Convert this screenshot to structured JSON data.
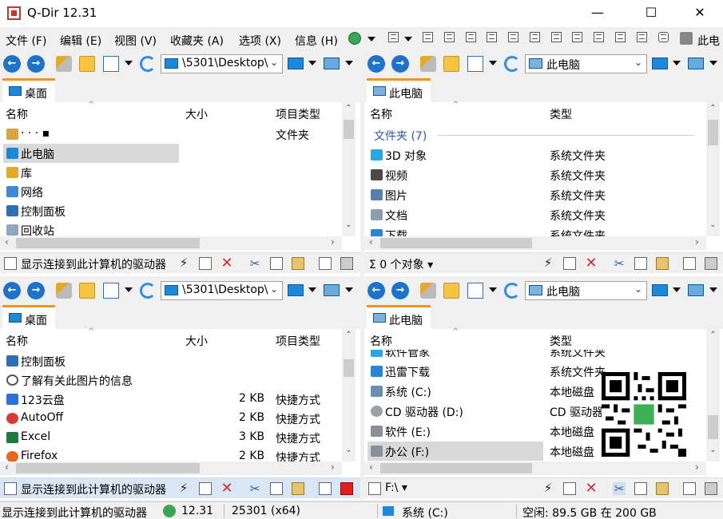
{
  "window": {
    "title": "Q-Dir 12.31",
    "min_glyph": "—",
    "max_glyph": "☐",
    "close_glyph": "✕"
  },
  "menu": {
    "items": [
      "文件 (F)",
      "编辑 (E)",
      "视图 (V)",
      "收藏夹 (A)",
      "选项 (X)",
      "信息 (H)"
    ],
    "this_pc": "此电"
  },
  "glyphs": {
    "back": "←",
    "forward": "→",
    "chevron": "⌄",
    "caret_up": "^",
    "left": "‹",
    "right": "›",
    "up": "⌃",
    "down": "⌄",
    "drop": "▾",
    "bolt": "⚡",
    "x": "✕",
    "cut": "✂"
  },
  "panes": {
    "top_left": {
      "address": "\\5301\\Desktop\\",
      "tab": "桌面",
      "columns": [
        "名称",
        "大小",
        "项目类型"
      ],
      "rows": [
        {
          "name": "· · ·  ▪",
          "size": "",
          "type": "文件夹",
          "icon_color": "#d9a441"
        },
        {
          "name": "此电脑",
          "size": "",
          "type": "",
          "icon_color": "#1e88d8",
          "selected": true
        },
        {
          "name": "库",
          "size": "",
          "type": "",
          "icon_color": "#e6a92a"
        },
        {
          "name": "网络",
          "size": "",
          "type": "",
          "icon_color": "#3a8ad6"
        },
        {
          "name": "控制面板",
          "size": "",
          "type": "",
          "icon_color": "#2f6fb5"
        },
        {
          "name": "回收站",
          "size": "",
          "type": "",
          "icon_color": "#8fa8c0"
        }
      ],
      "footer": "显示连接到此计算机的驱动器"
    },
    "top_right": {
      "address": "此电脑",
      "tab": "此电脑",
      "columns": [
        "名称",
        "类型"
      ],
      "group": "文件夹 (7)",
      "rows": [
        {
          "name": "3D 对象",
          "type": "系统文件夹",
          "icon_color": "#2aa6e0"
        },
        {
          "name": "视频",
          "type": "系统文件夹",
          "icon_color": "#4a4a4a"
        },
        {
          "name": "图片",
          "type": "系统文件夹",
          "icon_color": "#5a7fa8"
        },
        {
          "name": "文档",
          "type": "系统文件夹",
          "icon_color": "#8a9db3"
        },
        {
          "name": "下载",
          "type": "系统文件夹",
          "icon_color": "#2a86d1"
        }
      ],
      "footer": "Σ  0 个对象 ▾"
    },
    "bottom_left": {
      "address": "\\5301\\Desktop\\",
      "tab": "桌面",
      "columns": [
        "名称",
        "大小",
        "项目类型"
      ],
      "rows": [
        {
          "name": "控制面板",
          "size": "",
          "type": "",
          "icon_color": "#2f6fb5"
        },
        {
          "name": "了解有关此图片的信息",
          "size": "",
          "type": "",
          "icon_color": "#555555"
        },
        {
          "name": "123云盘",
          "size": "2 KB",
          "type": "快捷方式",
          "icon_color": "#2b6fdc"
        },
        {
          "name": "AutoOff",
          "size": "2 KB",
          "type": "快捷方式",
          "icon_color": "#d83a3a"
        },
        {
          "name": "Excel",
          "size": "3 KB",
          "type": "快捷方式",
          "icon_color": "#1d7a3e"
        },
        {
          "name": "Firefox",
          "size": "2 KB",
          "type": "快捷方式",
          "icon_color": "#e8661e"
        }
      ],
      "footer": "显示连接到此计算机的驱动器"
    },
    "bottom_right": {
      "address": "此电脑",
      "tab": "此电脑",
      "columns": [
        "名称",
        "类型"
      ],
      "rows": [
        {
          "name": "软件管家",
          "type": "系统文件夹",
          "icon_color": "#2aa6e0"
        },
        {
          "name": "迅雷下载",
          "type": "系统文件夹",
          "icon_color": "#2a86d1"
        },
        {
          "name": "系统 (C:)",
          "type": "本地磁盘",
          "icon_color": "#6b8fb0"
        },
        {
          "name": "CD 驱动器 (D:)",
          "type": "CD 驱动器",
          "icon_color": "#9aa0a6"
        },
        {
          "name": "软件 (E:)",
          "type": "本地磁盘",
          "icon_color": "#8a9099"
        },
        {
          "name": "办公 (F:)",
          "type": "本地磁盘",
          "icon_color": "#8a9099",
          "selected": true
        }
      ],
      "footer": "F:\\ ▾"
    }
  },
  "status": {
    "message": "显示连接到此计算机的驱动器",
    "version": "12.31",
    "build": "25301 (x64)",
    "drive": "系统 (C:)",
    "free": "空闲: 89.5 GB 在 200 GB"
  }
}
